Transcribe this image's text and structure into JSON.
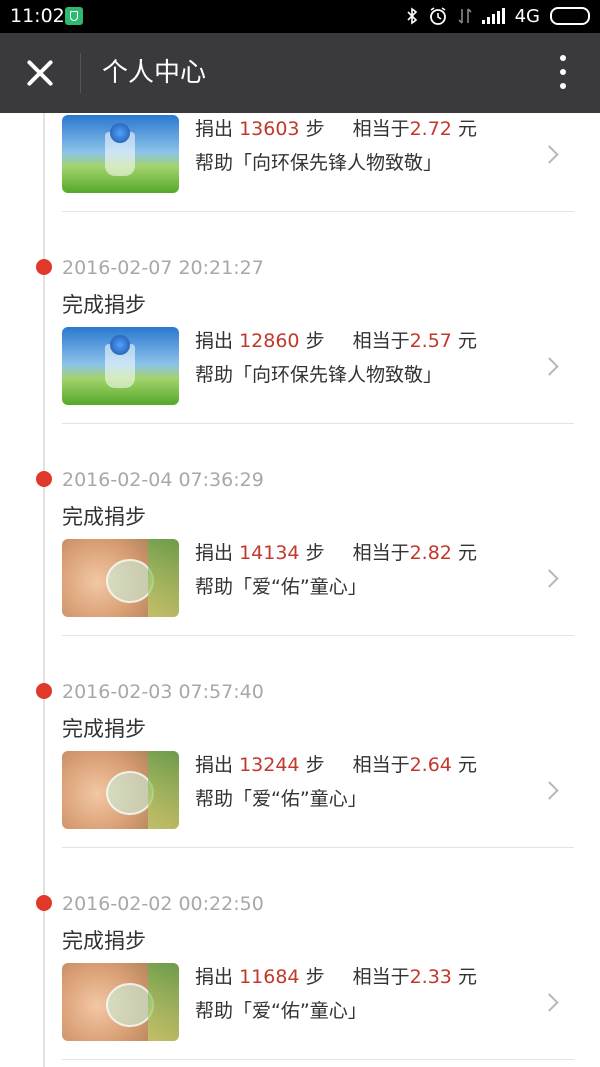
{
  "status_bar": {
    "time": "11:02",
    "network": "4G"
  },
  "nav": {
    "title": "个人中心"
  },
  "labels": {
    "donate_prefix": "捐出",
    "steps_unit": "步",
    "equiv": "相当于",
    "yuan": "元",
    "help_prefix": "帮助「",
    "help_suffix": "」",
    "completed": "完成捐步"
  },
  "entries": [
    {
      "timestamp": "",
      "steps": "13603",
      "amount": "2.72",
      "project": "向环保先锋人物致敬",
      "image": "plant-globe-thumbnail"
    },
    {
      "timestamp": "2016-02-07 20:21:27",
      "steps": "12860",
      "amount": "2.57",
      "project": "向环保先锋人物致敬",
      "image": "plant-globe-thumbnail"
    },
    {
      "timestamp": "2016-02-04 07:36:29",
      "steps": "14134",
      "amount": "2.82",
      "project": "爱“佑”童心",
      "image": "child-oxygen-mask-thumbnail"
    },
    {
      "timestamp": "2016-02-03 07:57:40",
      "steps": "13244",
      "amount": "2.64",
      "project": "爱“佑”童心",
      "image": "child-oxygen-mask-thumbnail"
    },
    {
      "timestamp": "2016-02-02 00:22:50",
      "steps": "11684",
      "amount": "2.33",
      "project": "爱“佑”童心",
      "image": "child-oxygen-mask-thumbnail"
    }
  ],
  "colors": {
    "accent_red": "#c1392b",
    "dot_red": "#e0392b",
    "navbar": "#3a3a3c"
  }
}
